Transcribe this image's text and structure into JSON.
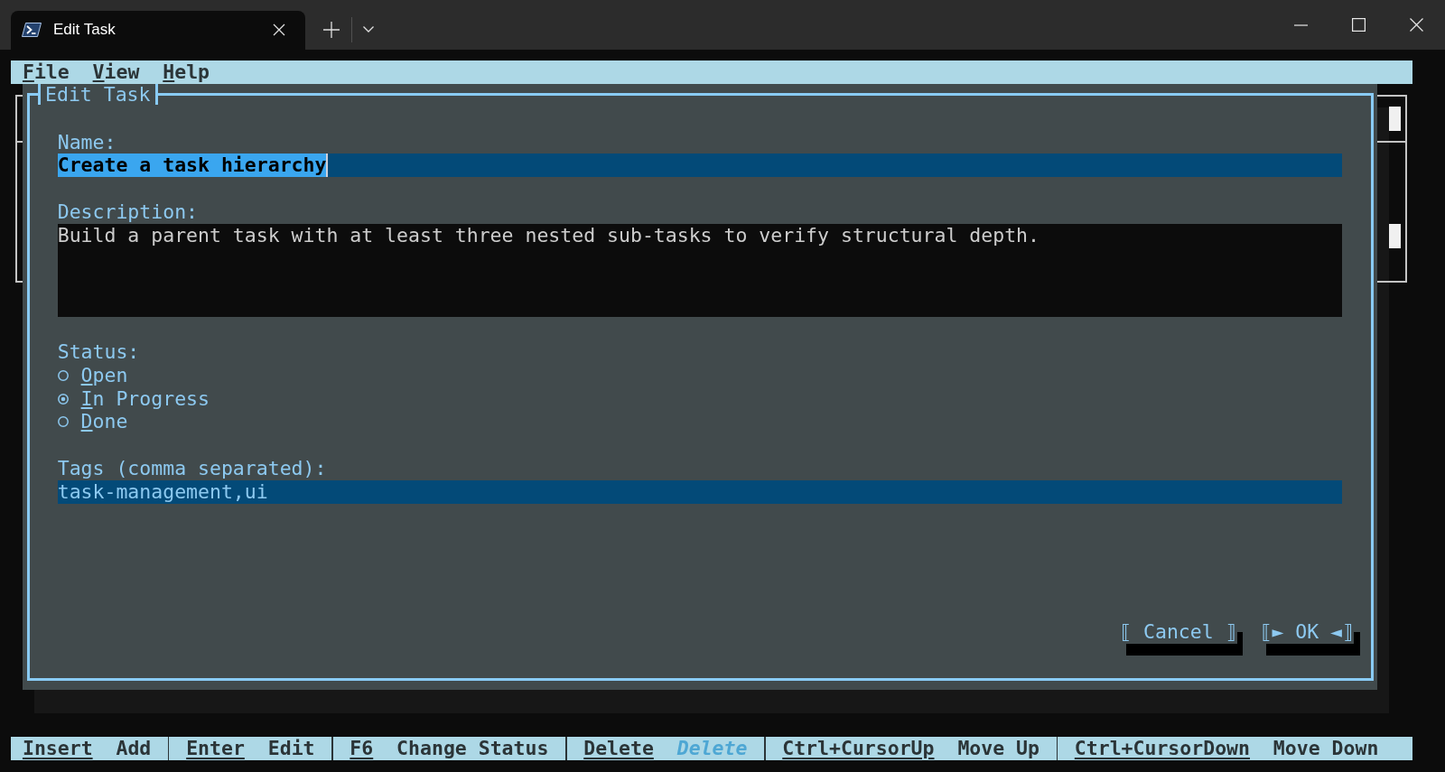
{
  "window": {
    "tabs": [
      {
        "title": "Edit Task",
        "selected": true
      }
    ]
  },
  "menu_bar": [
    {
      "hotkey": "F",
      "rest": "ile"
    },
    {
      "hotkey": "V",
      "rest": "iew"
    },
    {
      "hotkey": "H",
      "rest": "elp"
    }
  ],
  "dialog": {
    "title": "Edit Task",
    "name": {
      "label": "Name:",
      "value": "Create a task hierarchy",
      "text_selected": true
    },
    "description": {
      "label": "Description:",
      "value": "Build a parent task with at least three nested sub-tasks to verify structural depth."
    },
    "status": {
      "label": "Status:",
      "options": [
        {
          "hotkey": "O",
          "rest": "pen",
          "selected": false
        },
        {
          "hotkey": "I",
          "rest": "n Progress",
          "selected": true
        },
        {
          "hotkey": "D",
          "rest": "one",
          "selected": false
        }
      ]
    },
    "tags": {
      "label": "Tags (comma separated):",
      "value": "task-management,ui"
    },
    "buttons": [
      {
        "label": "⟦ Cancel ⟧"
      },
      {
        "label": "⟦► OK ◄⟧"
      }
    ]
  },
  "status_bar": [
    {
      "key": "Insert",
      "action": "Add",
      "disabled": false
    },
    {
      "key": "Enter",
      "action": "Edit",
      "disabled": false
    },
    {
      "key": "F6",
      "action": "Change Status",
      "disabled": false
    },
    {
      "key": "Delete",
      "action": "Delete",
      "disabled": true
    },
    {
      "key": "Ctrl+CursorUp",
      "action": "Move Up",
      "disabled": false
    },
    {
      "key": "Ctrl+CursorDown",
      "action": "Move Down",
      "disabled": false
    }
  ]
}
